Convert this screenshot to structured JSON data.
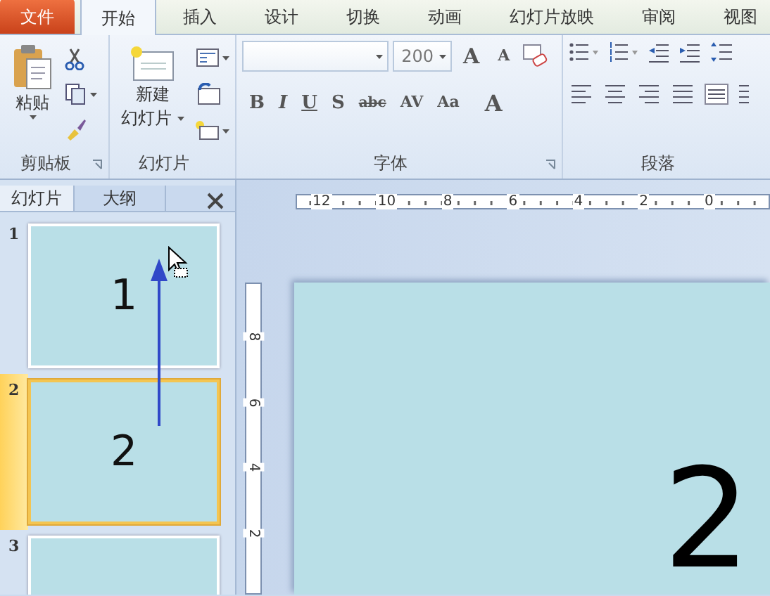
{
  "tabs": [
    {
      "label": "文件",
      "kind": "file",
      "selected": false
    },
    {
      "label": "开始",
      "kind": "tab",
      "selected": true
    },
    {
      "label": "插入",
      "kind": "tab",
      "selected": false
    },
    {
      "label": "设计",
      "kind": "tab",
      "selected": false
    },
    {
      "label": "切换",
      "kind": "tab",
      "selected": false
    },
    {
      "label": "动画",
      "kind": "tab",
      "selected": false
    },
    {
      "label": "幻灯片放映",
      "kind": "tab",
      "selected": false
    },
    {
      "label": "审阅",
      "kind": "tab",
      "selected": false
    },
    {
      "label": "视图",
      "kind": "tab",
      "selected": false
    }
  ],
  "ribbon": {
    "clipboard": {
      "paste": "粘贴",
      "label": "剪贴板"
    },
    "slides": {
      "new_slide": [
        "新建",
        "幻灯片"
      ],
      "label": "幻灯片"
    },
    "font": {
      "size": "200",
      "grow": "A",
      "shrink": "A",
      "format_buttons": [
        "B",
        "I",
        "U",
        "S",
        "abc",
        "AV",
        "Aa"
      ],
      "color_button": "A",
      "label": "字体"
    },
    "paragraph": {
      "label": "段落"
    }
  },
  "panel": {
    "tabs": [
      {
        "label": "幻灯片",
        "selected": true
      },
      {
        "label": "大纲",
        "selected": false
      }
    ]
  },
  "thumbnails": [
    {
      "number": "1",
      "text": "1",
      "selected": false
    },
    {
      "number": "2",
      "text": "2",
      "selected": true
    },
    {
      "number": "3",
      "selected": false
    }
  ],
  "ruler_h": [
    "12",
    "10",
    "8",
    "6",
    "4",
    "2",
    "0"
  ],
  "ruler_v": [
    "8",
    "6",
    "4",
    "2"
  ],
  "slide_text": "2"
}
